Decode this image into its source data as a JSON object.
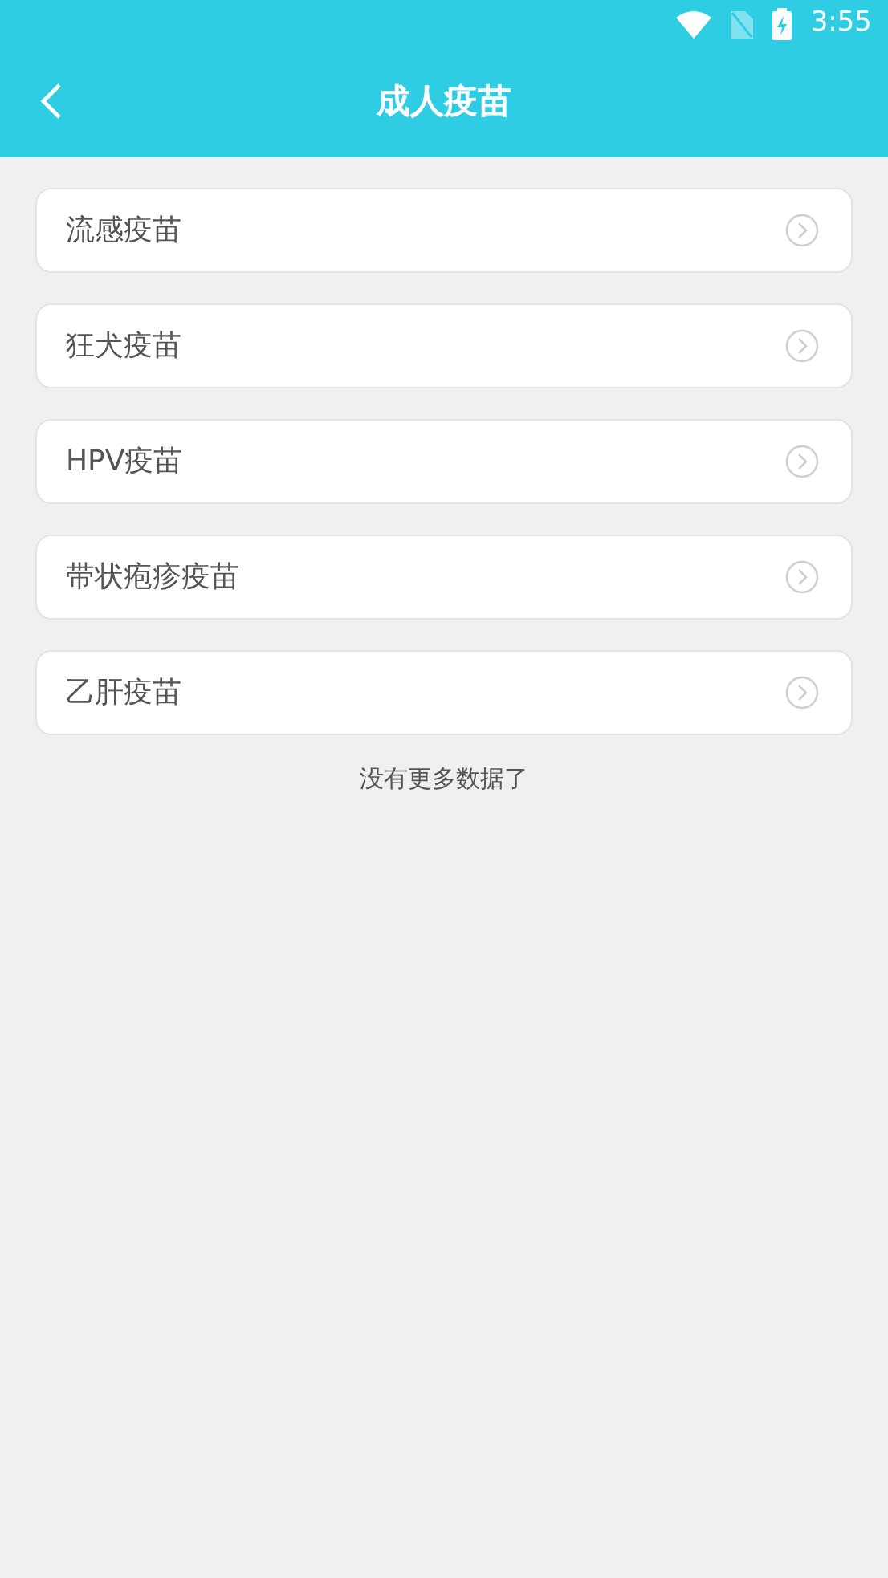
{
  "status_bar": {
    "time": "3:55"
  },
  "header": {
    "title": "成人疫苗"
  },
  "items": [
    {
      "label": "流感疫苗"
    },
    {
      "label": "狂犬疫苗"
    },
    {
      "label": "HPV疫苗"
    },
    {
      "label": "带状疱疹疫苗"
    },
    {
      "label": "乙肝疫苗"
    }
  ],
  "footer_note": "没有更多数据了"
}
